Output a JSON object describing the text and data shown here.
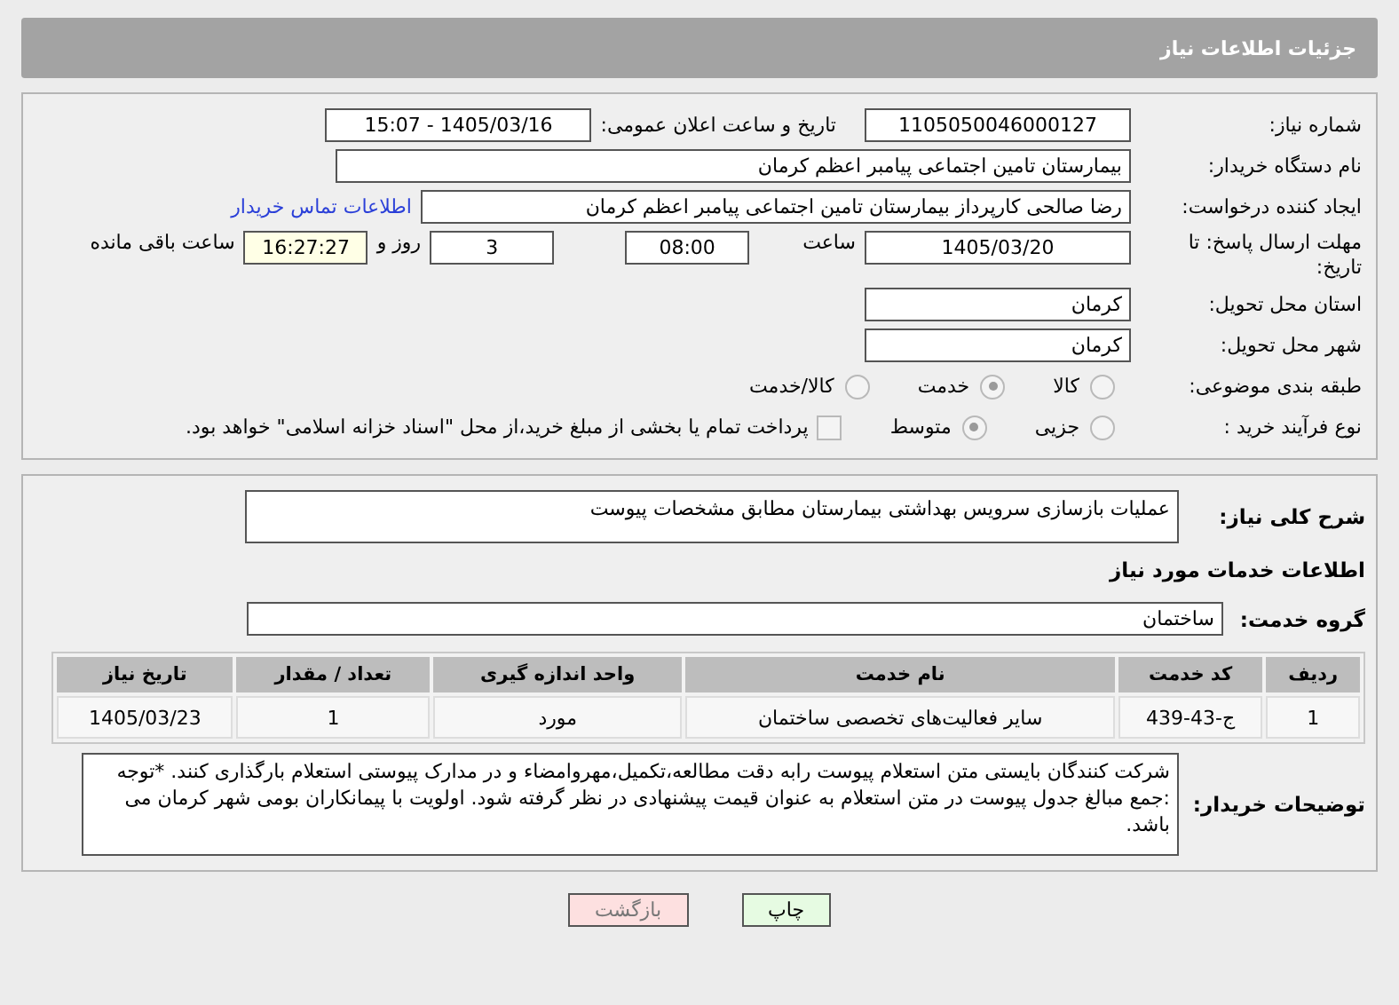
{
  "header": {
    "title": "جزئیات اطلاعات نیاز"
  },
  "need_info": {
    "need_number": {
      "label": "شماره نیاز:",
      "value": "1105050046000127"
    },
    "announce": {
      "label": "تاریخ و ساعت اعلان عمومی:",
      "value": "1405/03/16 - 15:07"
    },
    "buyer_org": {
      "label": "نام دستگاه خریدار:",
      "value": "بیمارستان تامین اجتماعی پیامبر اعظم کرمان"
    },
    "requester": {
      "label": "ایجاد کننده درخواست:",
      "value": "رضا صالحی  کارپرداز بیمارستان تامین اجتماعی پیامبر اعظم کرمان",
      "link": "اطلاعات تماس خریدار"
    },
    "deadline": {
      "label": "مهلت ارسال پاسخ: تا تاریخ:",
      "date": "1405/03/20",
      "time_label": "ساعت",
      "time": "08:00",
      "days": "3",
      "days_label": "روز و",
      "remaining": "16:27:27",
      "remaining_label": "ساعت باقی مانده"
    },
    "province": {
      "label": "استان محل تحویل:",
      "value": "کرمان"
    },
    "city": {
      "label": "شهر محل تحویل:",
      "value": "کرمان"
    },
    "category": {
      "label": "طبقه بندی موضوعی:",
      "options": [
        {
          "label": "کالا",
          "selected": false
        },
        {
          "label": "خدمت",
          "selected": true
        },
        {
          "label": "کالا/خدمت",
          "selected": false
        }
      ]
    },
    "process": {
      "label": "نوع فرآیند خرید :",
      "options": [
        {
          "label": "جزیی",
          "selected": false
        },
        {
          "label": "متوسط",
          "selected": true
        }
      ],
      "payment": {
        "checked": false,
        "text": "پرداخت تمام یا بخشی از مبلغ خرید،از محل \"اسناد خزانه اسلامی\" خواهد بود."
      }
    }
  },
  "services": {
    "summary": {
      "label": "شرح کلی نیاز:",
      "value": "عملیات بازسازی سرویس بهداشتی بیمارستان مطابق مشخصات پیوست"
    },
    "heading": "اطلاعات خدمات مورد نیاز",
    "group": {
      "label": "گروه خدمت:",
      "value": "ساختمان"
    },
    "table": {
      "columns": [
        "ردیف",
        "کد خدمت",
        "نام خدمت",
        "واحد اندازه گیری",
        "تعداد / مقدار",
        "تاریخ نیاز"
      ],
      "rows": [
        [
          "1",
          "ج-43-439",
          "سایر فعالیت‌های تخصصی ساختمان",
          "مورد",
          "1",
          "1405/03/23"
        ]
      ]
    },
    "notes": {
      "label": "توضیحات خریدار:",
      "value": "شرکت کنندگان بایستی متن استعلام پیوست رابه دقت مطالعه،تکمیل،مهروامضاء و در مدارک پیوستی استعلام بارگذاری کنند. *توجه :جمع مبالغ جدول پیوست در متن استعلام به عنوان قیمت پیشنهادی در نظر گرفته شود. اولویت با پیمانکاران بومی شهر کرمان می باشد."
    }
  },
  "buttons": [
    {
      "label": "چاپ",
      "kind": "print"
    },
    {
      "label": "بازگشت",
      "kind": "back"
    }
  ]
}
